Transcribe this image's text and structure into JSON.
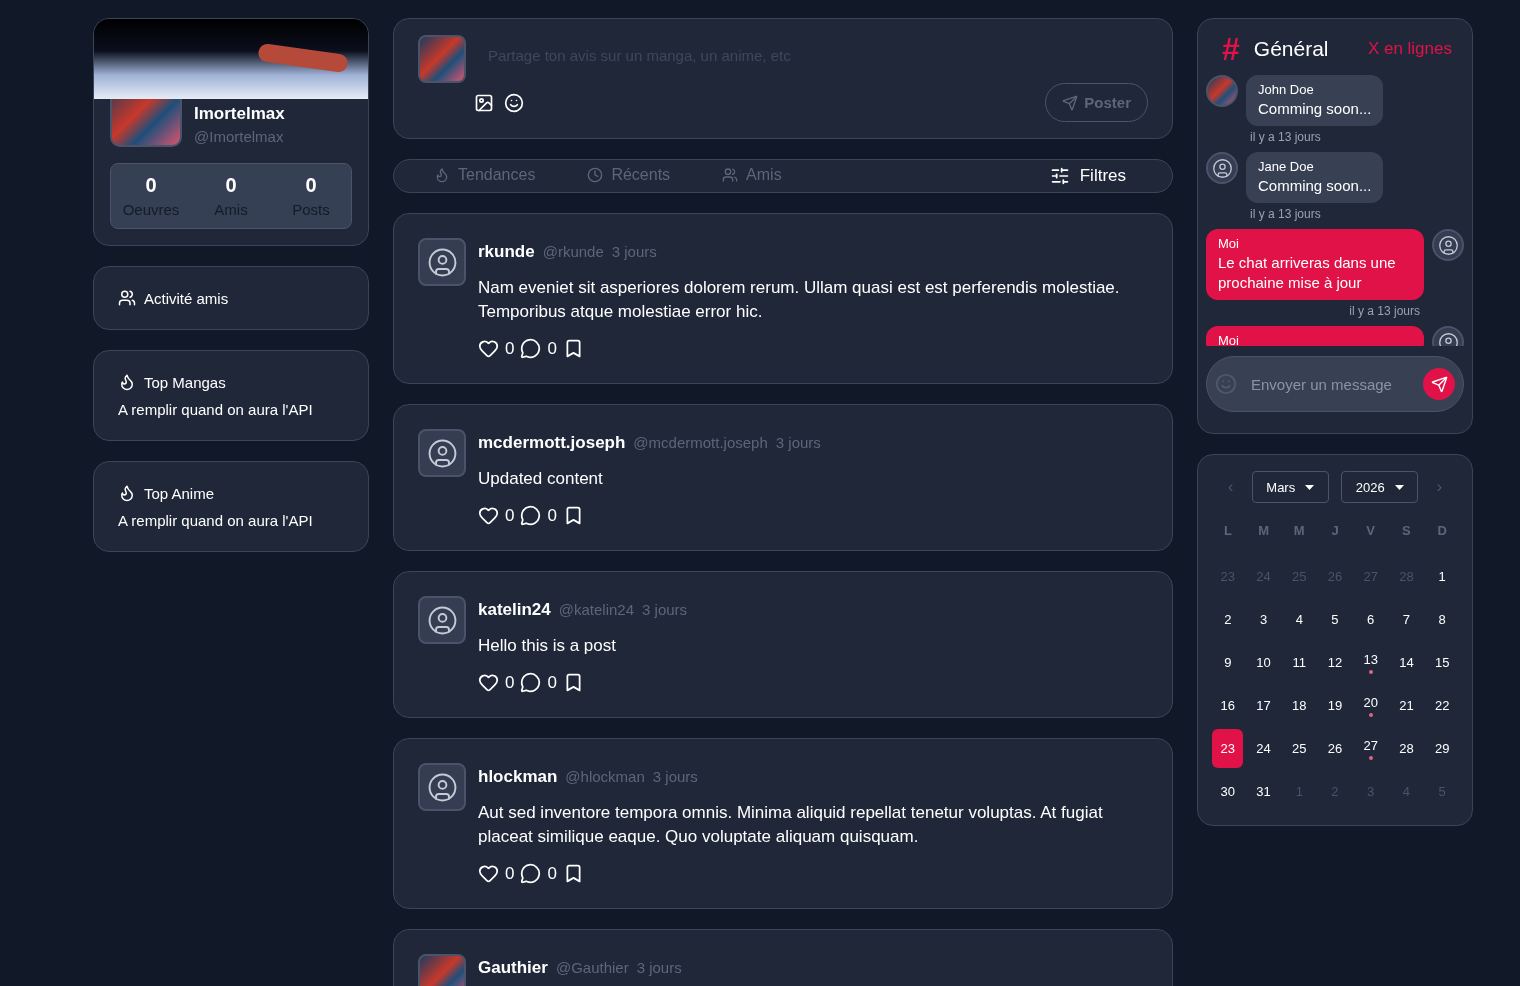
{
  "profile": {
    "name": "Imortelmax",
    "handle": "@Imortelmax",
    "stats": [
      {
        "value": "0",
        "label": "Oeuvres"
      },
      {
        "value": "0",
        "label": "Amis"
      },
      {
        "value": "0",
        "label": "Posts"
      }
    ]
  },
  "side_cards": [
    {
      "kind": "link",
      "title": "Activité amis"
    },
    {
      "kind": "top",
      "title": "Top Mangas",
      "text": "A remplir quand on aura l'API"
    },
    {
      "kind": "top",
      "title": "Top Anime",
      "text": "A remplir quand on aura l'API"
    }
  ],
  "composer": {
    "placeholder": "Partage ton avis sur un manga, un anime, etc",
    "submit": "Poster"
  },
  "tabs": [
    {
      "label": "Tendances",
      "selected": false
    },
    {
      "label": "Récents",
      "selected": false
    },
    {
      "label": "Amis",
      "selected": false
    }
  ],
  "filters": "Filtres",
  "posts": [
    {
      "kind": "placeholder",
      "author": "rkunde",
      "handle": "@rkunde",
      "time": "3 jours",
      "text": "Nam eveniet sit asperiores dolorem rerum. Ullam quasi est est perferendis molestiae. Temporibus atque molestiae error hic.",
      "likes": "0",
      "comments": "0"
    },
    {
      "kind": "placeholder",
      "author": "mcdermott.joseph",
      "handle": "@mcdermott.joseph",
      "time": "3 jours",
      "text": "Updated content",
      "likes": "0",
      "comments": "0"
    },
    {
      "kind": "placeholder",
      "author": "katelin24",
      "handle": "@katelin24",
      "time": "3 jours",
      "text": "Hello this is a post",
      "likes": "0",
      "comments": "0"
    },
    {
      "kind": "placeholder",
      "author": "hlockman",
      "handle": "@hlockman",
      "time": "3 jours",
      "text": "Aut sed inventore tempora omnis. Minima aliquid repellat tenetur voluptas. At fugiat placeat similique eaque. Quo voluptate aliquam quisquam.",
      "likes": "0",
      "comments": "0"
    },
    {
      "kind": "photo",
      "author": "Gauthier",
      "handle": "@Gauthier",
      "time": "3 jours"
    }
  ],
  "chat": {
    "channel_icon": "#",
    "channel": "Général",
    "online": "X en lignes",
    "messages": [
      {
        "kind": "photo",
        "mine": false,
        "author": "John Doe",
        "text": "Comming soon...",
        "time": "il y a 13 jours"
      },
      {
        "kind": "placeholder",
        "mine": false,
        "author": "Jane Doe",
        "text": "Comming soon...",
        "time": "il y a 13 jours"
      },
      {
        "kind": "placeholder",
        "mine": true,
        "author": "Moi",
        "text": "Le chat arriveras dans une prochaine mise à jour",
        "time": "il y a 13 jours"
      },
      {
        "kind": "placeholder",
        "mine": true,
        "author": "Moi"
      }
    ],
    "placeholder": "Envoyer un message"
  },
  "calendar": {
    "prev": "‹",
    "next": "›",
    "month": "Mars",
    "year": "2026",
    "weekdays": [
      "L",
      "M",
      "M",
      "J",
      "V",
      "S",
      "D"
    ],
    "days": [
      {
        "label": "23",
        "muted": true,
        "selected": false,
        "event": false
      },
      {
        "label": "24",
        "muted": true,
        "selected": false,
        "event": false
      },
      {
        "label": "25",
        "muted": true,
        "selected": false,
        "event": false
      },
      {
        "label": "26",
        "muted": true,
        "selected": false,
        "event": false
      },
      {
        "label": "27",
        "muted": true,
        "selected": false,
        "event": false
      },
      {
        "label": "28",
        "muted": true,
        "selected": false,
        "event": false
      },
      {
        "label": "1",
        "muted": false,
        "selected": false,
        "event": false
      },
      {
        "label": "2",
        "muted": false,
        "selected": false,
        "event": false
      },
      {
        "label": "3",
        "muted": false,
        "selected": false,
        "event": false
      },
      {
        "label": "4",
        "muted": false,
        "selected": false,
        "event": false
      },
      {
        "label": "5",
        "muted": false,
        "selected": false,
        "event": false
      },
      {
        "label": "6",
        "muted": false,
        "selected": false,
        "event": false
      },
      {
        "label": "7",
        "muted": false,
        "selected": false,
        "event": false
      },
      {
        "label": "8",
        "muted": false,
        "selected": false,
        "event": false
      },
      {
        "label": "9",
        "muted": false,
        "selected": false,
        "event": false
      },
      {
        "label": "10",
        "muted": false,
        "selected": false,
        "event": false
      },
      {
        "label": "11",
        "muted": false,
        "selected": false,
        "event": false
      },
      {
        "label": "12",
        "muted": false,
        "selected": false,
        "event": false
      },
      {
        "label": "13",
        "muted": false,
        "selected": false,
        "event": true
      },
      {
        "label": "14",
        "muted": false,
        "selected": false,
        "event": false
      },
      {
        "label": "15",
        "muted": false,
        "selected": false,
        "event": false
      },
      {
        "label": "16",
        "muted": false,
        "selected": false,
        "event": false
      },
      {
        "label": "17",
        "muted": false,
        "selected": false,
        "event": false
      },
      {
        "label": "18",
        "muted": false,
        "selected": false,
        "event": false
      },
      {
        "label": "19",
        "muted": false,
        "selected": false,
        "event": false
      },
      {
        "label": "20",
        "muted": false,
        "selected": false,
        "event": true
      },
      {
        "label": "21",
        "muted": false,
        "selected": false,
        "event": false
      },
      {
        "label": "22",
        "muted": false,
        "selected": false,
        "event": false
      },
      {
        "label": "23",
        "muted": false,
        "selected": true,
        "event": false
      },
      {
        "label": "24",
        "muted": false,
        "selected": false,
        "event": false
      },
      {
        "label": "25",
        "muted": false,
        "selected": false,
        "event": false
      },
      {
        "label": "26",
        "muted": false,
        "selected": false,
        "event": false
      },
      {
        "label": "27",
        "muted": false,
        "selected": false,
        "event": true
      },
      {
        "label": "28",
        "muted": false,
        "selected": false,
        "event": false
      },
      {
        "label": "29",
        "muted": false,
        "selected": false,
        "event": false
      },
      {
        "label": "30",
        "muted": false,
        "selected": false,
        "event": false
      },
      {
        "label": "31",
        "muted": false,
        "selected": false,
        "event": false
      },
      {
        "label": "1",
        "muted": true,
        "selected": false,
        "event": false
      },
      {
        "label": "2",
        "muted": true,
        "selected": false,
        "event": false
      },
      {
        "label": "3",
        "muted": true,
        "selected": false,
        "event": false
      },
      {
        "label": "4",
        "muted": true,
        "selected": false,
        "event": false
      },
      {
        "label": "5",
        "muted": true,
        "selected": false,
        "event": false
      }
    ]
  }
}
